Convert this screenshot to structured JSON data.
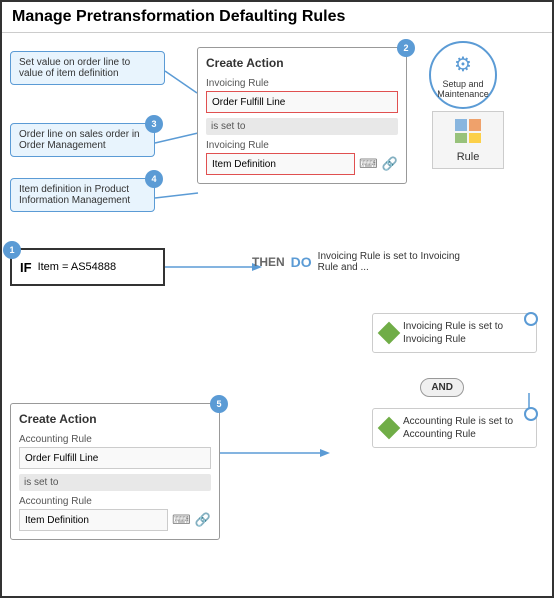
{
  "page": {
    "title": "Manage Pretransformation Defaulting Rules"
  },
  "setup": {
    "label": "Setup and Maintenance",
    "gear": "⚙",
    "rule_label": "Rule"
  },
  "annotations": {
    "ann1": "Set value  on order line to value of item definition",
    "ann3_badge": "3",
    "ann3": "Order line on sales order in Order Management",
    "ann4_badge": "4",
    "ann4": "Item definition in Product Information Management"
  },
  "create_action_top": {
    "title": "Create Action",
    "badge": "2",
    "label1": "Invoicing Rule",
    "input1": "Order Fulfill Line",
    "is_set_to": "is set to",
    "label2": "Invoicing Rule",
    "input2": "Item Definition"
  },
  "if_block": {
    "badge": "1",
    "if_label": "IF",
    "condition": "Item = AS54888"
  },
  "then_do": {
    "then_label": "THEN",
    "do_label": "DO",
    "do_text": "Invoicing Rule is set to Invoicing Rule and ..."
  },
  "result_box_1": {
    "text": "Invoicing Rule is set to Invoicing Rule"
  },
  "and_label": "AND",
  "result_box_2": {
    "text": "Accounting Rule is set to Accounting Rule"
  },
  "create_action_bottom": {
    "title": "Create Action",
    "badge": "5",
    "label1": "Accounting Rule",
    "input1": "Order Fulfill Line",
    "is_set_to": "is set to",
    "label2": "Accounting Rule",
    "input2": "Item Definition"
  }
}
